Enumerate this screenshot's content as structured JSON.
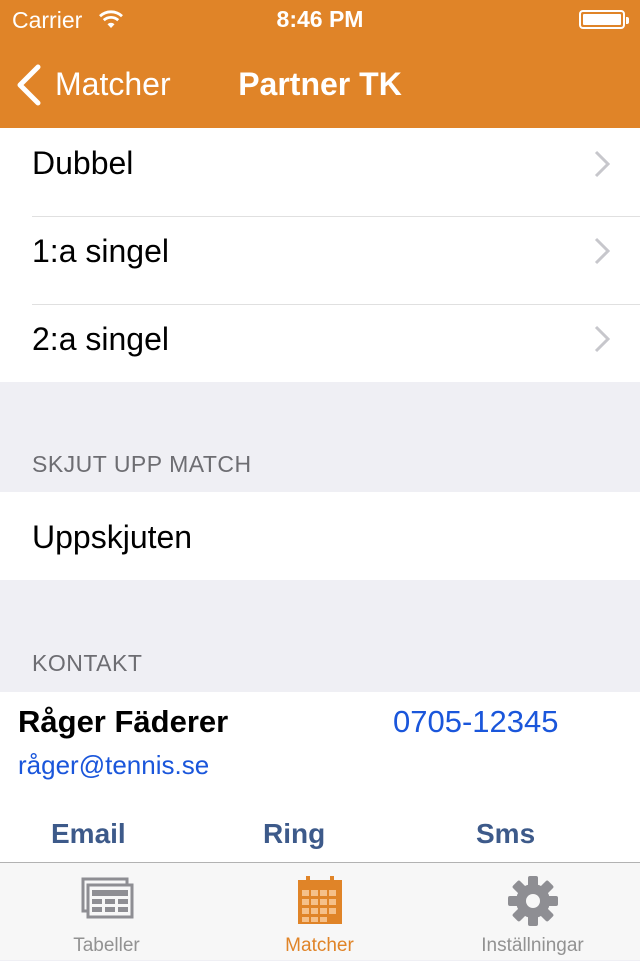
{
  "status_bar": {
    "carrier": "Carrier",
    "time": "8:46 PM"
  },
  "nav": {
    "back_label": "Matcher",
    "title": "Partner TK"
  },
  "matches": [
    {
      "label": "Dubbel"
    },
    {
      "label": "1:a singel"
    },
    {
      "label": "2:a singel"
    }
  ],
  "postpone": {
    "header": "SKJUT UPP MATCH",
    "item_label": "Uppskjuten"
  },
  "contact": {
    "header": "KONTAKT",
    "name": "Råger Fäderer",
    "phone": "0705-12345",
    "email": "råger@tennis.se",
    "email_button": "Email",
    "call_button": "Ring",
    "sms_button": "Sms"
  },
  "tabs": [
    {
      "label": "Tabeller",
      "icon": "tables-icon"
    },
    {
      "label": "Matcher",
      "icon": "calendar-icon",
      "active": true
    },
    {
      "label": "Inställningar",
      "icon": "gear-icon"
    }
  ],
  "colors": {
    "accent": "#e08428",
    "link": "#1a56db",
    "action": "#3d5a8a"
  }
}
